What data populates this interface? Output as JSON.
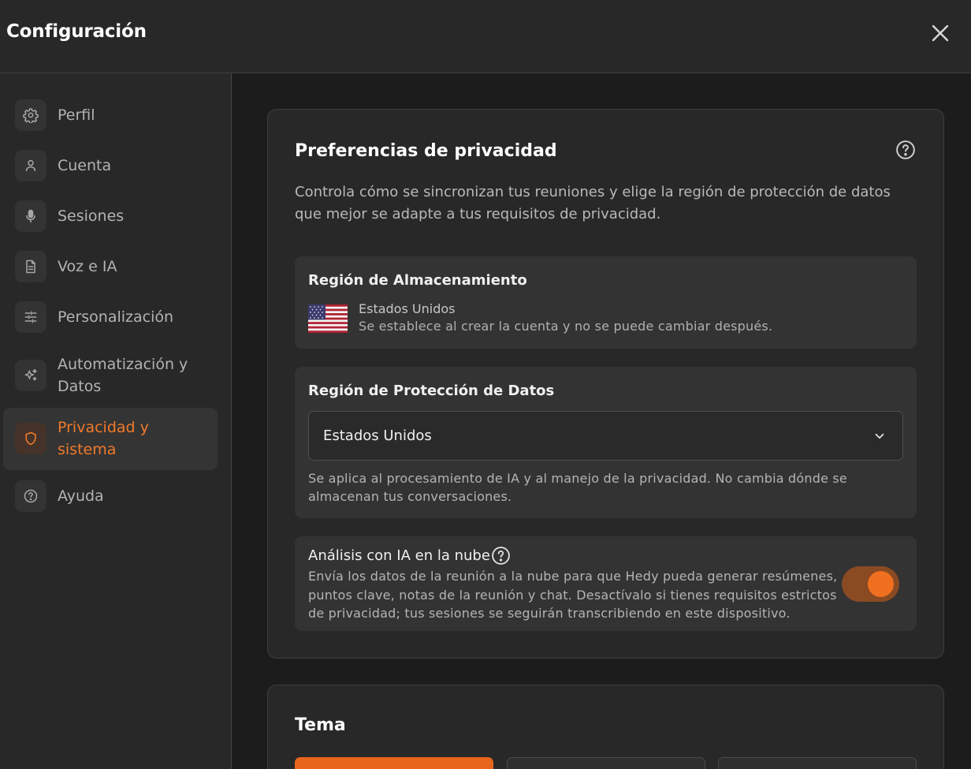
{
  "header": {
    "title": "Configuración"
  },
  "sidebar": {
    "items": [
      {
        "label": "Perfil",
        "icon": "gear-icon"
      },
      {
        "label": "Cuenta",
        "icon": "user-icon"
      },
      {
        "label": "Sesiones",
        "icon": "microphone-icon"
      },
      {
        "label": "Voz e IA",
        "icon": "document-icon"
      },
      {
        "label": "Personalización",
        "icon": "sliders-icon"
      },
      {
        "label": "Automatización y Datos",
        "icon": "sparkles-icon"
      },
      {
        "label": "Privacidad y sistema",
        "icon": "shield-icon",
        "active": true
      },
      {
        "label": "Ayuda",
        "icon": "help-circle-icon"
      }
    ]
  },
  "privacy": {
    "title": "Preferencias de privacidad",
    "description": "Controla cómo se sincronizan tus reuniones y elige la región de protección de datos que mejor se adapte a tus requisitos de privacidad.",
    "storage": {
      "title": "Región de Almacenamiento",
      "region": "Estados Unidos",
      "note": "Se establece al crear la cuenta y no se puede cambiar después."
    },
    "protection": {
      "title": "Región de Protección de Datos",
      "selected": "Estados Unidos",
      "note": "Se aplica al procesamiento de IA y al manejo de la privacidad. No cambia dónde se almacenan tus conversaciones."
    },
    "ai": {
      "title": "Análisis con IA en la nube",
      "description": "Envía los datos de la reunión a la nube para que Hedy pueda generar resúmenes, puntos clave, notas de la reunión y chat. Desactívalo si tienes requisitos estrictos de privacidad; tus sesiones se seguirán transcribiendo en este dispositivo.",
      "enabled": true
    }
  },
  "theme": {
    "title": "Tema"
  },
  "colors": {
    "accent": "#f07a2a",
    "background": "#1c1c1c",
    "panel": "#282828"
  }
}
